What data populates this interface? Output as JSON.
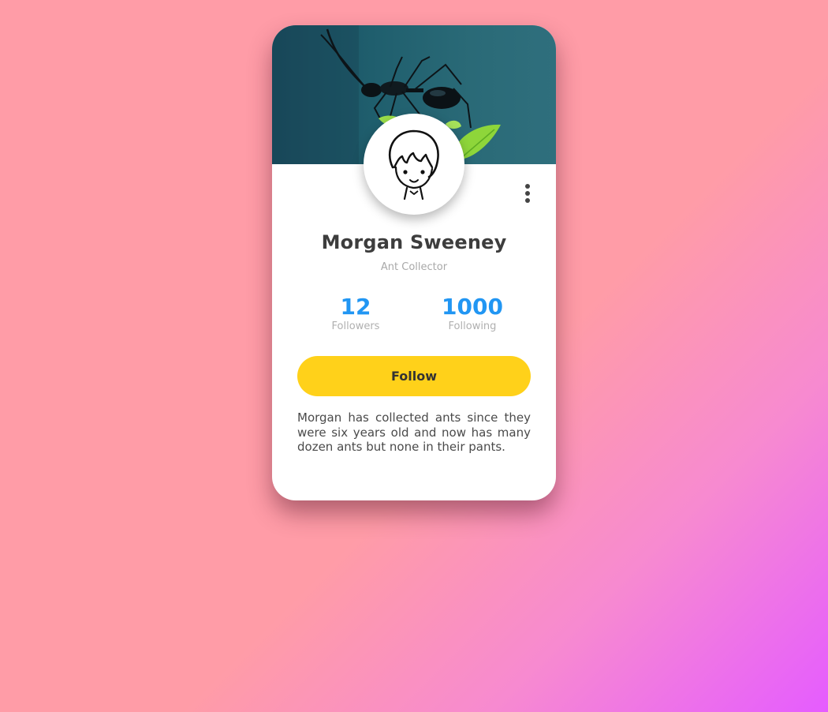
{
  "profile": {
    "name": "Morgan Sweeney",
    "title": "Ant Collector",
    "stats": {
      "followers_count": "12",
      "followers_label": "Followers",
      "following_count": "1000",
      "following_label": "Following"
    },
    "follow_button_label": "Follow",
    "bio": "Morgan has collected ants since they were six years old and now has many dozen ants but none in their pants."
  },
  "icons": {
    "menu": "more-vertical-icon",
    "avatar": "cartoon-avatar-icon",
    "cover": "ant-on-leaf-photo"
  },
  "colors": {
    "background_start": "#ff9ca7",
    "background_end": "#e55cff",
    "card": "#ffffff",
    "stat_number": "#2196f3",
    "follow_button": "#ffd11a",
    "name_text": "#3d3d3d",
    "muted_text": "#a9a9a9"
  }
}
